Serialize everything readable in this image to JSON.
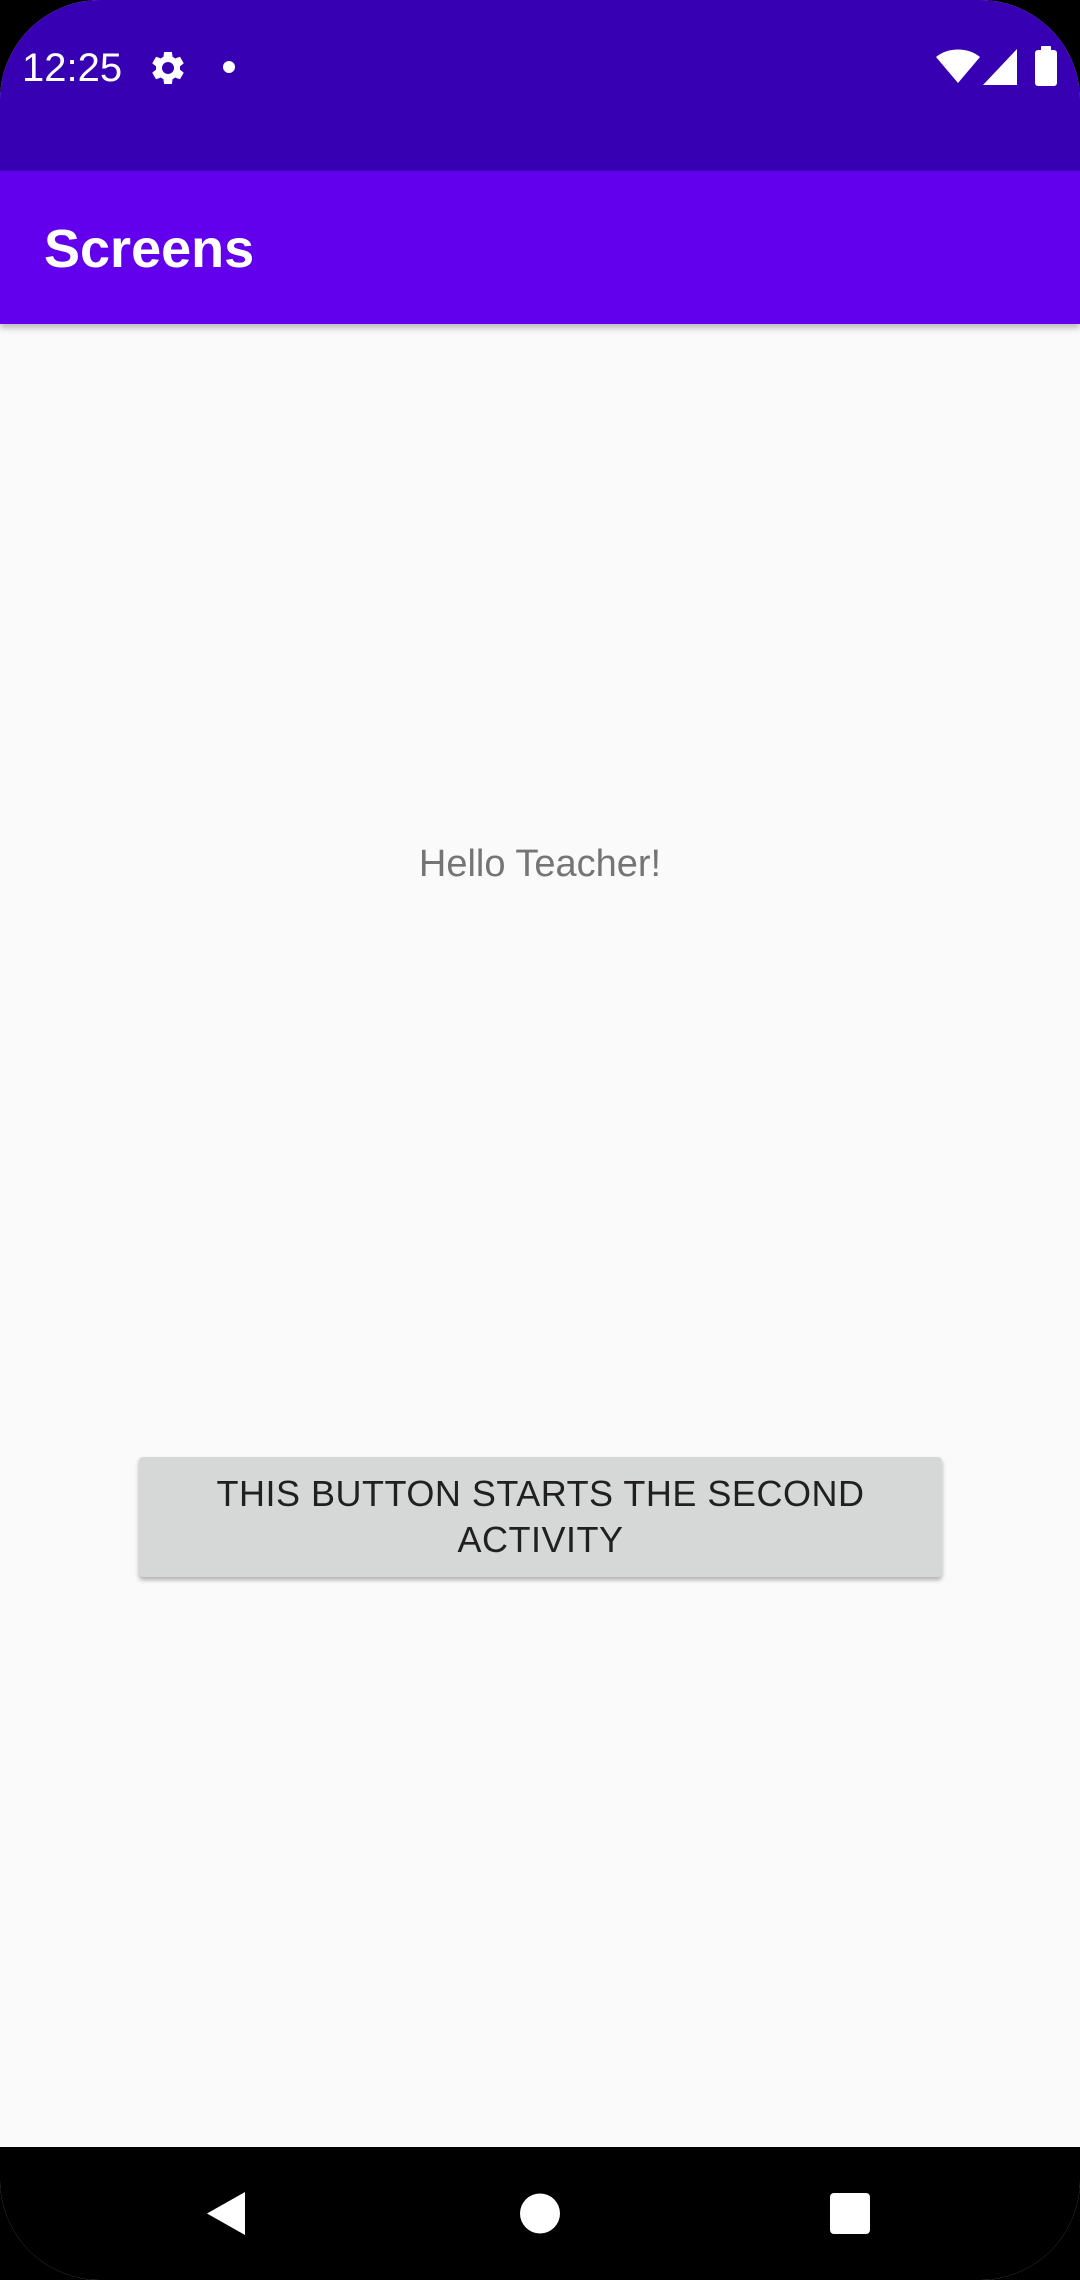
{
  "status_bar": {
    "time": "12:25",
    "left_icons": [
      "settings-icon",
      "notification-dot-icon"
    ],
    "right_icons": [
      "wifi-icon",
      "cellular-signal-icon",
      "battery-icon"
    ],
    "background_color": "#3700b3"
  },
  "app_bar": {
    "title": "Screens",
    "background_color": "#6200ee"
  },
  "main": {
    "greeting": "Hello Teacher!",
    "button_label": "THIS BUTTON STARTS THE SECOND ACTIVITY"
  },
  "nav_bar": {
    "buttons": [
      "back-icon",
      "home-icon",
      "recents-icon"
    ]
  }
}
